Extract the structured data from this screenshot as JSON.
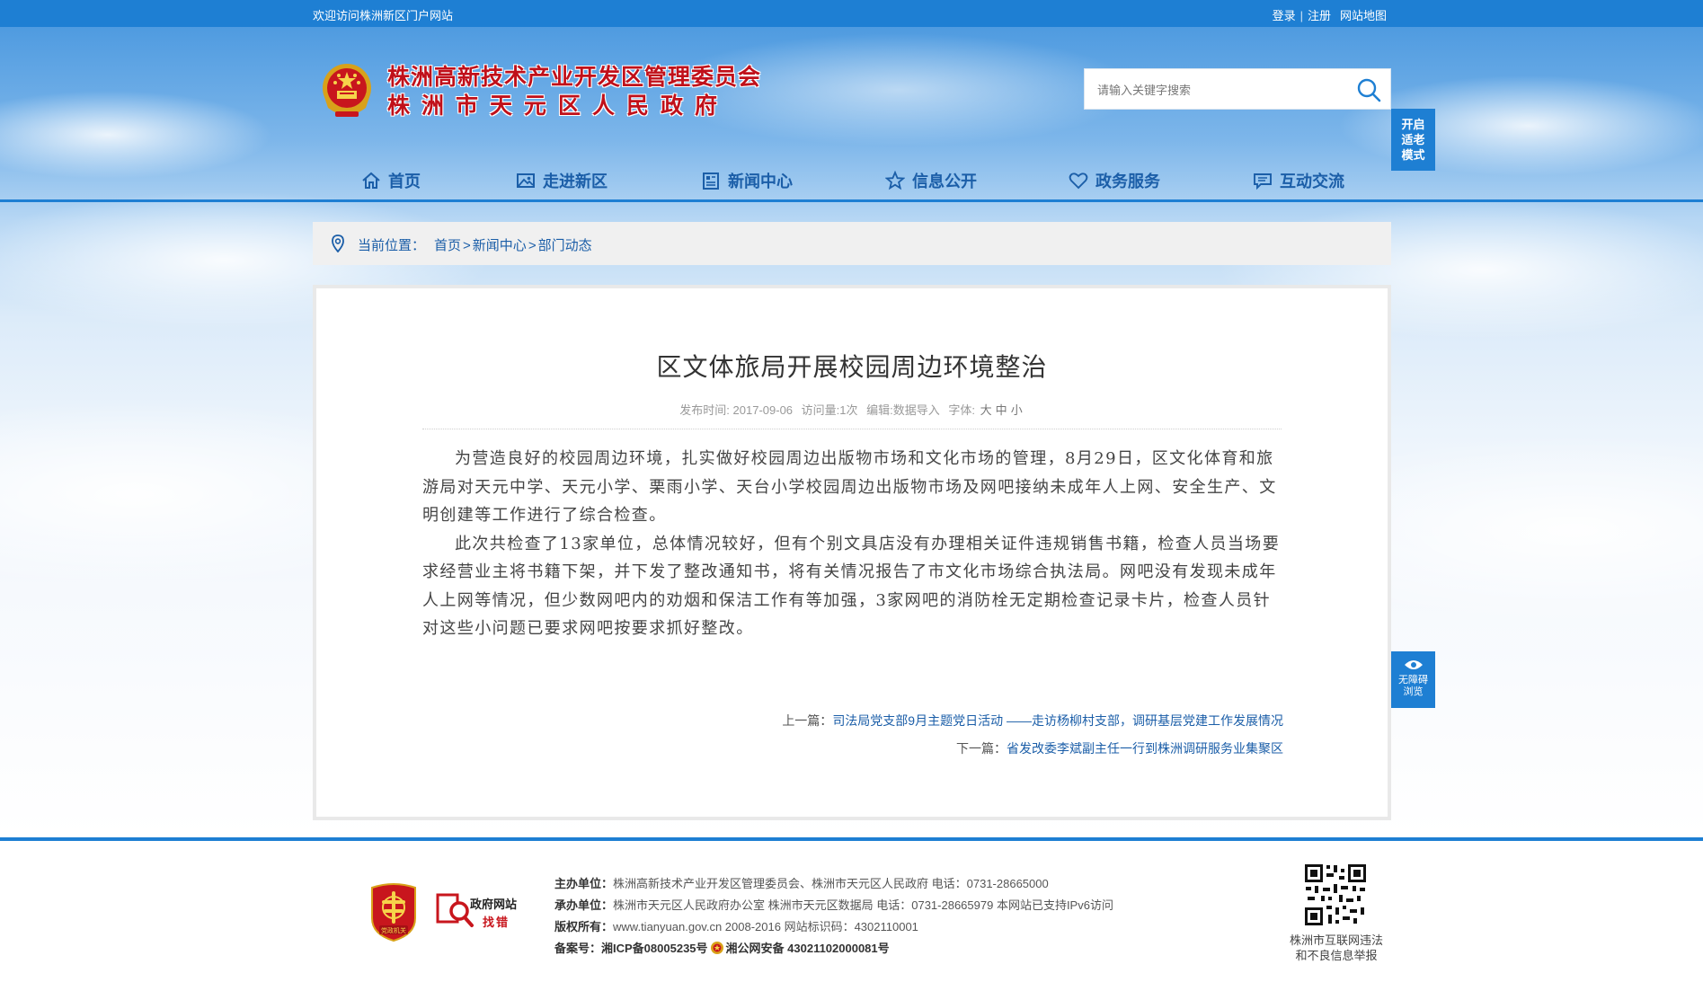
{
  "topbar": {
    "welcome": "欢迎访问株洲新区门户网站",
    "login": "登录",
    "sep": "|",
    "register": "注册",
    "sitemap": "网站地图"
  },
  "header": {
    "title_line1": "株洲高新技术产业开发区管理委员会",
    "title_line2": "株洲市天元区人民政府",
    "search_placeholder": "请输入关键字搜索",
    "elder_mode": [
      "开启",
      "适老",
      "模式"
    ]
  },
  "nav": [
    {
      "label": "首页",
      "icon": "home-icon"
    },
    {
      "label": "走进新区",
      "icon": "picture-icon"
    },
    {
      "label": "新闻中心",
      "icon": "newspaper-icon"
    },
    {
      "label": "信息公开",
      "icon": "star-icon"
    },
    {
      "label": "政务服务",
      "icon": "heart-icon"
    },
    {
      "label": "互动交流",
      "icon": "chat-icon"
    }
  ],
  "breadcrumb": {
    "prefix": "当前位置：",
    "items": [
      "首页",
      "新闻中心",
      "部门动态"
    ],
    "sep": ">"
  },
  "article": {
    "title": "区文体旅局开展校园周边环境整治",
    "meta": {
      "published_label": "发布时间:",
      "published": "2017-09-06",
      "views_label": "访问量:",
      "views": "1次",
      "editor_label": "编辑:",
      "editor": "数据导入",
      "font_label": "字体:",
      "font_sizes": [
        "大",
        "中",
        "小"
      ]
    },
    "paragraphs": [
      "为营造良好的校园周边环境，扎实做好校园周边出版物市场和文化市场的管理，8月29日，区文化体育和旅游局对天元中学、天元小学、栗雨小学、天台小学校园周边出版物市场及网吧接纳未成年人上网、安全生产、文明创建等工作进行了综合检查。",
      "此次共检查了13家单位，总体情况较好，但有个别文具店没有办理相关证件违规销售书籍，检查人员当场要求经营业主将书籍下架，并下发了整改通知书，将有关情况报告了市文化市场综合执法局。网吧没有发现未成年人上网等情况，但少数网吧内的劝烟和保洁工作有等加强，3家网吧的消防栓无定期检查记录卡片，检查人员针对这些小问题已要求网吧按要求抓好整改。"
    ],
    "prev_label": "上一篇：",
    "prev": "司法局党支部9月主题党日活动 ——走访杨柳村支部，调研基层党建工作发展情况",
    "next_label": "下一篇：",
    "next": "省发改委李斌副主任一行到株洲调研服务业集聚区"
  },
  "accessibility": {
    "label": [
      "无障碍",
      "浏览"
    ]
  },
  "footer": {
    "badge_dang": "党政机关",
    "badge_zf_line1": "政府网站",
    "badge_zf_line2": "找错",
    "host_label": "主办单位：",
    "host": "株洲高新技术产业开发区管理委员会、株洲市天元区人民政府 电话：0731-28665000",
    "org_label": "承办单位：",
    "org": "株洲市天元区人民政府办公室 株洲市天元区数据局 电话：0731-28665979 本网站已支持IPv6访问",
    "copyright_label": "版权所有：",
    "copyright": "www.tianyuan.gov.cn 2008-2016 网站标识码：4302110001",
    "icp_label": "备案号：",
    "icp": "湘ICP备08005235号",
    "police": "湘公网安备 43021102000081号",
    "qr_caption": [
      "株洲市互联网违法",
      "和不良信息举报"
    ]
  },
  "colors": {
    "primary": "#1e7fd3",
    "nav_text": "#1b5ea8",
    "logo_red": "#c0101a",
    "badge_red": "#c8161d"
  }
}
